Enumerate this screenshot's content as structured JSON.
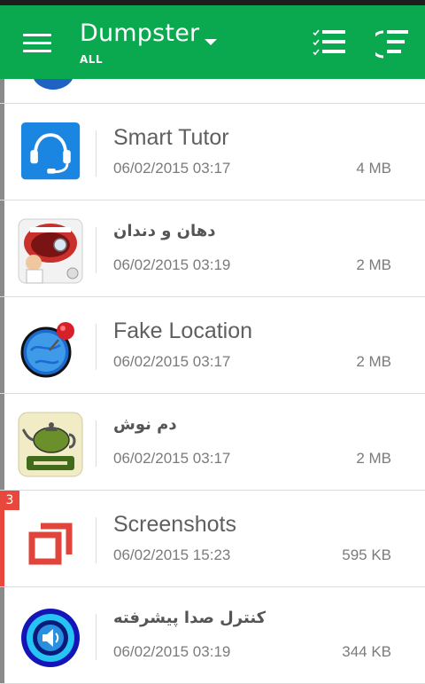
{
  "colors": {
    "toolbar": "#0aa84f",
    "stripe": "#8a8a8a",
    "accent_red": "#e8473c"
  },
  "toolbar": {
    "title": "Dumpster",
    "subtitle": "ALL",
    "menu_icon": "hamburger-menu-icon",
    "dropdown_icon": "chevron-down-icon",
    "select_icon": "checklist-icon",
    "sort_icon": "sort-icon"
  },
  "items": [
    {
      "name": "Smart Tutor",
      "date": "06/02/2015 03:17",
      "size": "4 MB",
      "icon": "headset-icon"
    },
    {
      "name": "دهان و دندان",
      "date": "06/02/2015 03:19",
      "size": "2 MB",
      "icon": "dentist-app-icon"
    },
    {
      "name": "Fake Location",
      "date": "06/02/2015 03:17",
      "size": "2 MB",
      "icon": "globe-pin-icon"
    },
    {
      "name": "دم نوش",
      "date": "06/02/2015 03:17",
      "size": "2 MB",
      "icon": "teapot-icon"
    },
    {
      "name": "Screenshots",
      "date": "06/02/2015 15:23",
      "size": "595 KB",
      "icon": "screenshots-folder-icon",
      "badge": "3"
    },
    {
      "name": "کنترل صدا پیشرفته",
      "date": "06/02/2015 03:19",
      "size": "344 KB",
      "icon": "speaker-icon"
    }
  ]
}
